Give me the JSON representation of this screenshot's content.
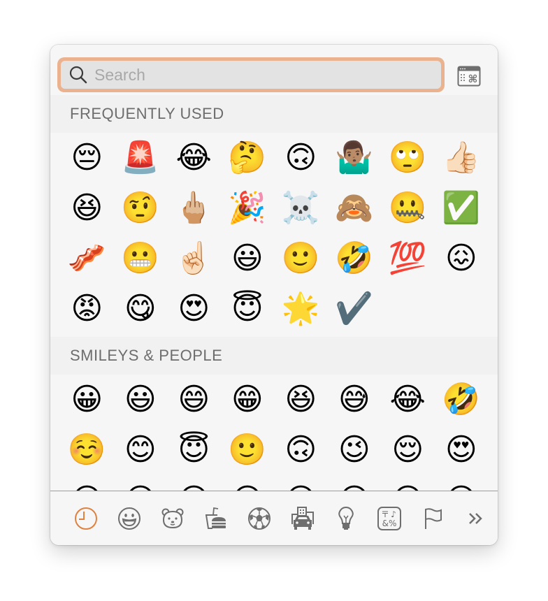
{
  "search": {
    "placeholder": "Search",
    "value": "",
    "icon": "magnifying-glass-icon",
    "focus_ring_color": "#eab28e"
  },
  "keyboard_viewer_button": {
    "icon": "character-viewer-icon",
    "label": "Show Character Viewer"
  },
  "sections": [
    {
      "title": "FREQUENTLY USED",
      "emojis": [
        {
          "char": "😔",
          "name": "pensive-face"
        },
        {
          "char": "🚨",
          "name": "police-car-light"
        },
        {
          "char": "😂",
          "name": "face-with-tears-of-joy"
        },
        {
          "char": "🤔",
          "name": "thinking-face"
        },
        {
          "char": "🙃",
          "name": "upside-down-face"
        },
        {
          "char": "🤷🏽‍♂️",
          "name": "man-shrugging"
        },
        {
          "char": "🙄",
          "name": "face-with-rolling-eyes"
        },
        {
          "char": "👍🏻",
          "name": "thumbs-up"
        },
        {
          "char": "😆",
          "name": "grinning-squinting-face"
        },
        {
          "char": "🤨",
          "name": "face-with-raised-eyebrow"
        },
        {
          "char": "🖕🏼",
          "name": "middle-finger"
        },
        {
          "char": "🎉",
          "name": "party-popper"
        },
        {
          "char": "☠️",
          "name": "skull-and-crossbones"
        },
        {
          "char": "🙈",
          "name": "see-no-evil-monkey"
        },
        {
          "char": "🤐",
          "name": "zipper-mouth-face"
        },
        {
          "char": "✅",
          "name": "check-mark-button"
        },
        {
          "char": "🥓",
          "name": "bacon"
        },
        {
          "char": "😬",
          "name": "grimacing-face"
        },
        {
          "char": "☝🏻",
          "name": "index-pointing-up"
        },
        {
          "char": "😃",
          "name": "grinning-face-with-big-eyes"
        },
        {
          "char": "🙂",
          "name": "slightly-smiling-face"
        },
        {
          "char": "🤣",
          "name": "rolling-on-the-floor-laughing"
        },
        {
          "char": "💯",
          "name": "hundred-points"
        },
        {
          "char": "😖",
          "name": "confounded-face"
        },
        {
          "char": "😡",
          "name": "pouting-face"
        },
        {
          "char": "😋",
          "name": "face-savoring-food"
        },
        {
          "char": "😍",
          "name": "smiling-face-with-heart-eyes"
        },
        {
          "char": "😇",
          "name": "smiling-face-with-halo"
        },
        {
          "char": "🌟",
          "name": "glowing-star"
        },
        {
          "char": "✔️",
          "name": "check-mark"
        }
      ]
    },
    {
      "title": "SMILEYS & PEOPLE",
      "emojis": [
        {
          "char": "😀",
          "name": "grinning-face"
        },
        {
          "char": "😃",
          "name": "grinning-face-with-big-eyes"
        },
        {
          "char": "😄",
          "name": "grinning-face-with-smiling-eyes"
        },
        {
          "char": "😁",
          "name": "beaming-face-with-smiling-eyes"
        },
        {
          "char": "😆",
          "name": "grinning-squinting-face"
        },
        {
          "char": "😅",
          "name": "grinning-face-with-sweat"
        },
        {
          "char": "😂",
          "name": "face-with-tears-of-joy"
        },
        {
          "char": "🤣",
          "name": "rolling-on-the-floor-laughing"
        },
        {
          "char": "☺️",
          "name": "smiling-face"
        },
        {
          "char": "😊",
          "name": "smiling-face-with-smiling-eyes"
        },
        {
          "char": "😇",
          "name": "smiling-face-with-halo"
        },
        {
          "char": "🙂",
          "name": "slightly-smiling-face"
        },
        {
          "char": "🙃",
          "name": "upside-down-face"
        },
        {
          "char": "😉",
          "name": "winking-face"
        },
        {
          "char": "😌",
          "name": "relieved-face"
        },
        {
          "char": "😍",
          "name": "smiling-face-with-heart-eyes"
        },
        {
          "char": "😘",
          "name": "face-blowing-a-kiss"
        },
        {
          "char": "😗",
          "name": "kissing-face"
        },
        {
          "char": "😙",
          "name": "kissing-face-with-smiling-eyes"
        },
        {
          "char": "😚",
          "name": "kissing-face-with-closed-eyes"
        },
        {
          "char": "😋",
          "name": "face-savoring-food"
        },
        {
          "char": "😛",
          "name": "face-with-tongue"
        },
        {
          "char": "😝",
          "name": "squinting-face-with-tongue"
        },
        {
          "char": "😜",
          "name": "winking-face-with-tongue"
        }
      ]
    }
  ],
  "category_tabs": [
    {
      "name": "frequently-used",
      "icon": "clock-icon",
      "active": true
    },
    {
      "name": "smileys-people",
      "icon": "smiley-icon",
      "active": false
    },
    {
      "name": "animals-nature",
      "icon": "bear-icon",
      "active": false
    },
    {
      "name": "food-drink",
      "icon": "food-icon",
      "active": false
    },
    {
      "name": "activity",
      "icon": "soccer-ball-icon",
      "active": false
    },
    {
      "name": "travel-places",
      "icon": "car-building-icon",
      "active": false
    },
    {
      "name": "objects",
      "icon": "lightbulb-icon",
      "active": false
    },
    {
      "name": "symbols",
      "icon": "symbols-icon",
      "active": false
    },
    {
      "name": "flags",
      "icon": "flag-icon",
      "active": false
    },
    {
      "name": "more",
      "icon": "chevron-double-right-icon",
      "active": false
    }
  ],
  "colors": {
    "accent": "#e0813f",
    "icon_gray": "#6e6e6e",
    "header_text": "#6d6d6d"
  }
}
